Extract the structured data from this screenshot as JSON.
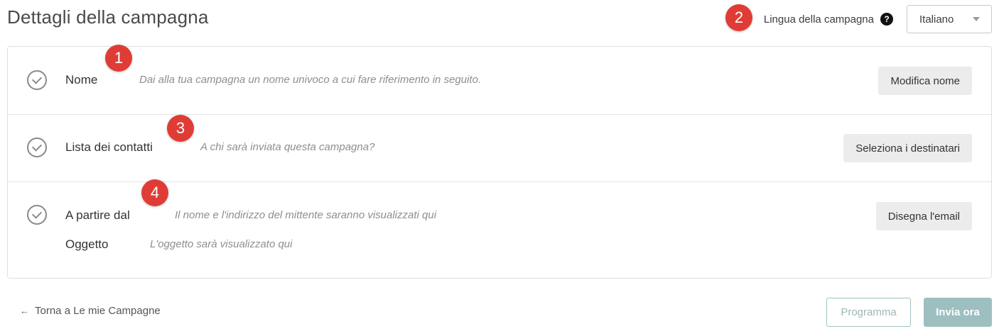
{
  "page": {
    "title": "Dettagli della campagna"
  },
  "language": {
    "label": "Lingua della campagna",
    "help": "?",
    "selected": "Italiano"
  },
  "rows": [
    {
      "label": "Nome",
      "description": "Dai alla tua campagna un nome univoco a cui fare riferimento in seguito.",
      "button": "Modifica nome"
    },
    {
      "label": "Lista dei contatti",
      "description": "A chi sarà inviata questa campagna?",
      "button": "Seleziona i destinatari"
    },
    {
      "label": "A partire dal",
      "description": "Il nome e l'indirizzo del mittente saranno visualizzati qui",
      "button": "Disegna l'email",
      "sub_label": "Oggetto",
      "sub_description": "L'oggetto sarà visualizzato qui"
    }
  ],
  "badges": [
    "1",
    "2",
    "3",
    "4"
  ],
  "footer": {
    "back_arrow": "←",
    "back_label": "Torna a Le mie Campagne",
    "schedule_label": "Programma",
    "send_label": "Invia ora"
  },
  "colors": {
    "badge": "#e03c36",
    "primary_disabled": "#9dbfbf",
    "outline_disabled": "#9fc3c3"
  }
}
